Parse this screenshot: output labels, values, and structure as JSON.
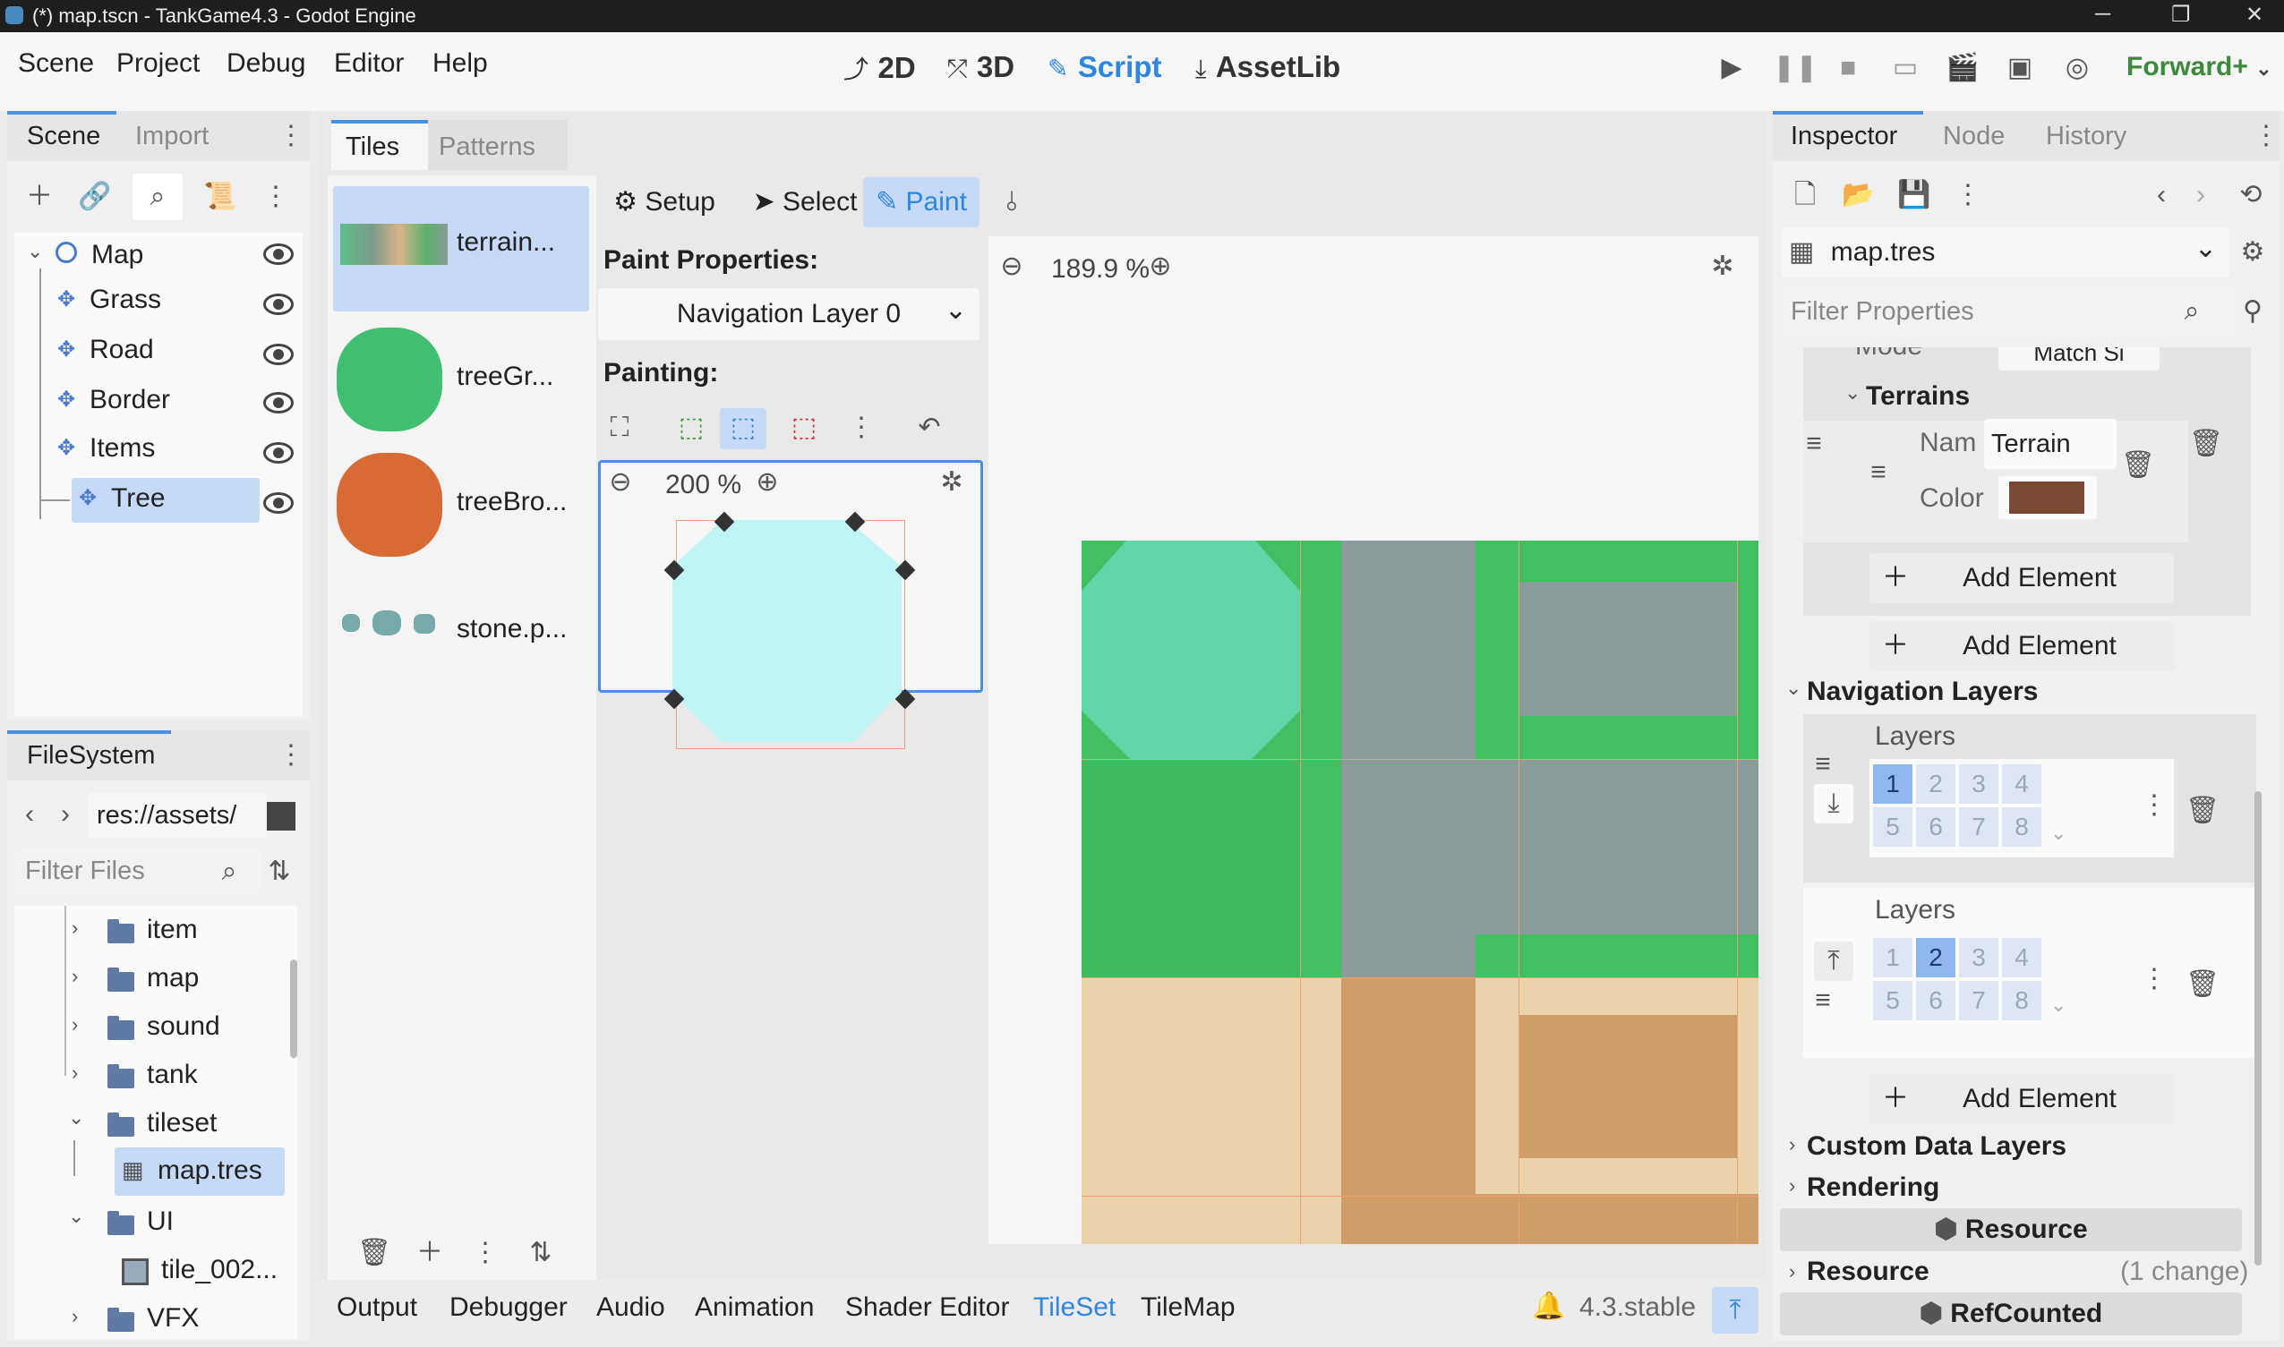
{
  "window": {
    "title": "(*) map.tscn - TankGame4.3 - Godot Engine"
  },
  "menu": {
    "items": [
      "Scene",
      "Project",
      "Debug",
      "Editor",
      "Help"
    ]
  },
  "modes": {
    "d2": "2D",
    "d3": "3D",
    "script": "Script",
    "assetlib": "AssetLib"
  },
  "renderer": "Forward+",
  "scene_dock": {
    "tabs": [
      "Scene",
      "Import"
    ],
    "root": "Map",
    "children": [
      "Grass",
      "Road",
      "Border",
      "Items",
      "Tree"
    ],
    "selected": "Tree"
  },
  "filesystem": {
    "tab": "FileSystem",
    "path": "res://assets/",
    "filter_placeholder": "Filter Files",
    "entries": [
      "item",
      "map",
      "sound",
      "tank",
      "tileset",
      "map.tres",
      "UI",
      "tile_002...",
      "VFX"
    ]
  },
  "tileset": {
    "tabs": [
      "Tiles",
      "Patterns"
    ],
    "sources": [
      "terrain...",
      "treeGr...",
      "treeBro...",
      "stone.p..."
    ],
    "toolbar": {
      "setup": "Setup",
      "select": "Select",
      "paint": "Paint"
    },
    "paint_properties_label": "Paint Properties:",
    "nav_layer_option": "Navigation Layer 0",
    "painting_label": "Painting:",
    "preview_zoom": "200 %",
    "atlas_zoom": "189.9 %"
  },
  "bottom_tabs": [
    "Output",
    "Debugger",
    "Audio",
    "Animation",
    "Shader Editor",
    "TileSet",
    "TileMap"
  ],
  "bottom_active": "TileSet",
  "version": "4.3.stable",
  "inspector": {
    "tabs": [
      "Inspector",
      "Node",
      "History"
    ],
    "resource": "map.tres",
    "filter_placeholder": "Filter Properties",
    "mode_label": "Mode",
    "mode_value": "Match Si",
    "terrains_label": "Terrains",
    "name_label": "Nam",
    "name_value": "Terrain",
    "color_label": "Color",
    "terrain_color": "#7a4a35",
    "add_element": "Add Element",
    "nav_layers_label": "Navigation Layers",
    "layers_label": "Layers",
    "layer_bits": [
      "1",
      "2",
      "3",
      "4",
      "5",
      "6",
      "7",
      "8"
    ],
    "layer1_selected": "1",
    "layer2_selected": "2",
    "custom_data_layers": "Custom Data Layers",
    "rendering": "Rendering",
    "resource_section": "Resource",
    "resource_row": "Resource",
    "change_count": "(1 change)",
    "refcounted": "RefCounted"
  }
}
